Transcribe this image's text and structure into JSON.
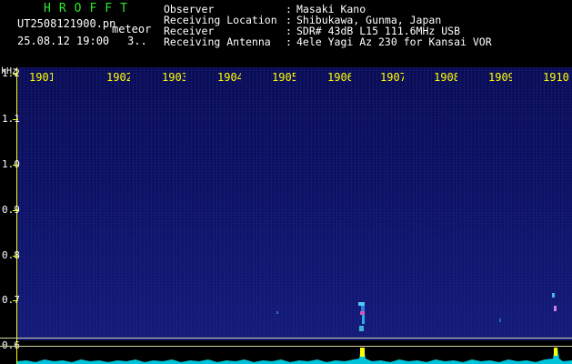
{
  "header": {
    "app_title": "HROFFT",
    "filename": "UT2508121900.pn",
    "file_type": "meteor",
    "date_time": "25.08.12 19:00",
    "count": "3..",
    "info": [
      {
        "label": "Observer",
        "value": "Masaki Kano"
      },
      {
        "label": "Receiving Location",
        "value": "Shibukawa, Gunma, Japan"
      },
      {
        "label": "Receiver",
        "value": "SDR# 43dB L15 111.6MHz USB"
      },
      {
        "label": "Receiving Antenna",
        "value": "4ele Yagi Az 230 for Kansai VOR"
      }
    ]
  },
  "axes": {
    "y_unit": "kHz",
    "x_ticks": [
      "1901",
      "1902",
      "1903",
      "1904",
      "1905",
      "1906",
      "1907",
      "1908",
      "1909",
      "1910"
    ],
    "y_ticks": [
      "1.2",
      "1.1",
      "1.0",
      "0.9",
      "0.8",
      "0.7",
      "0.6"
    ]
  },
  "colors": {
    "title": "#2ee82e",
    "axis": "#ffff00",
    "text": "#ffffff",
    "background": "#0c1060",
    "spectrum": "#00e5ff",
    "echo": "#ffff00"
  }
}
